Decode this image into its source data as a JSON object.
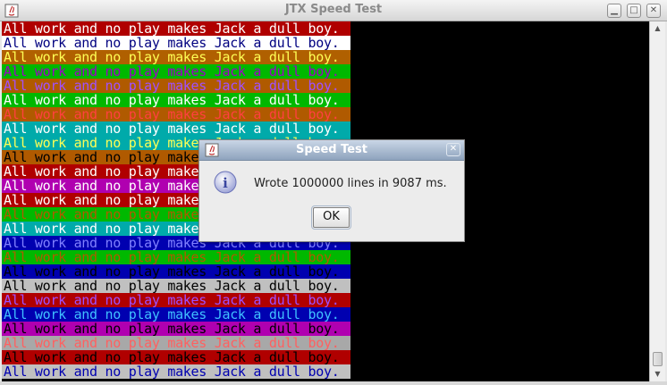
{
  "window": {
    "title": "JTX Speed Test"
  },
  "window_controls": {
    "minimize": "▁",
    "maximize": "□",
    "close": "✕"
  },
  "terminal": {
    "text": "All work and no play makes Jack a dull boy.",
    "background": "#000000",
    "lines": [
      {
        "fg": "#ffffff",
        "bg": "#b00000"
      },
      {
        "fg": "#000080",
        "bg": "#ffffff"
      },
      {
        "fg": "#ffff55",
        "bg": "#b06000"
      },
      {
        "fg": "#9e00c8",
        "bg": "#00b800"
      },
      {
        "fg": "#a050ff",
        "bg": "#b05a00"
      },
      {
        "fg": "#ffffff",
        "bg": "#00b800"
      },
      {
        "fg": "#ff4040",
        "bg": "#b05a00"
      },
      {
        "fg": "#ffffff",
        "bg": "#00aaaa"
      },
      {
        "fg": "#ffff55",
        "bg": "#00aaaa"
      },
      {
        "fg": "#000000",
        "bg": "#b05a00"
      },
      {
        "fg": "#ffffff",
        "bg": "#b00000"
      },
      {
        "fg": "#ffffff",
        "bg": "#b000b0"
      },
      {
        "fg": "#ffffff",
        "bg": "#b00000"
      },
      {
        "fg": "#b05a00",
        "bg": "#00b800"
      },
      {
        "fg": "#ffffff",
        "bg": "#00aaaa"
      },
      {
        "fg": "#8080ff",
        "bg": "#0000b0"
      },
      {
        "fg": "#b05a00",
        "bg": "#00b800"
      },
      {
        "fg": "#000000",
        "bg": "#0000b0"
      },
      {
        "fg": "#000000",
        "bg": "#c0c0c0"
      },
      {
        "fg": "#9e50ff",
        "bg": "#b00000"
      },
      {
        "fg": "#40c0ff",
        "bg": "#0000b0"
      },
      {
        "fg": "#000000",
        "bg": "#b000b0"
      },
      {
        "fg": "#ff6060",
        "bg": "#a8a8a8"
      },
      {
        "fg": "#000000",
        "bg": "#b00000"
      },
      {
        "fg": "#0000b0",
        "bg": "#c0c0c0"
      }
    ]
  },
  "dialog": {
    "title": "Speed Test",
    "message": "Wrote 1000000 lines in 9087 ms.",
    "ok_label": "OK",
    "close_glyph": "✕"
  }
}
